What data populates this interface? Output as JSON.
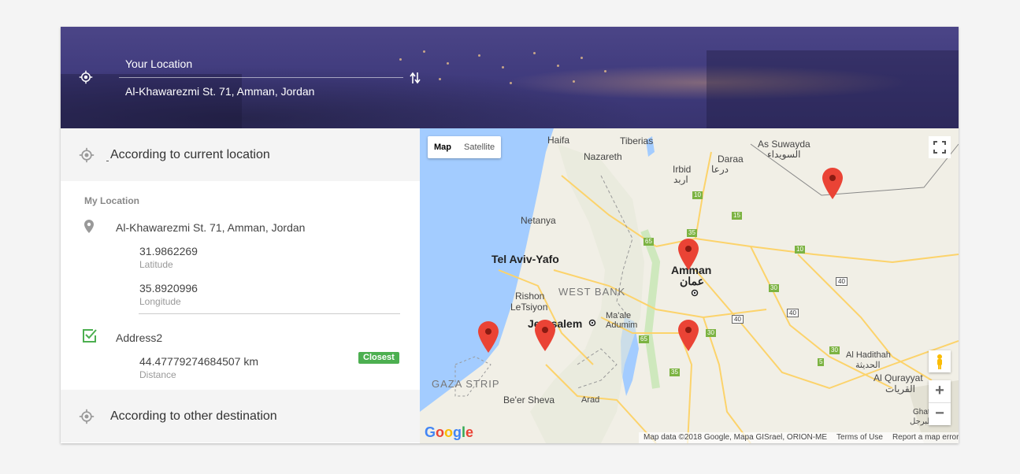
{
  "header": {
    "from_label": "Your Location",
    "to_label": "Al-Khawarezmi St. 71, Amman, Jordan",
    "icons": {
      "location": "crosshair-icon",
      "swap": "swap-vertical-icon"
    },
    "color": "#443f82"
  },
  "sections": {
    "current": {
      "label": "According to current location"
    },
    "other": {
      "label": "According to other destination"
    }
  },
  "details": {
    "heading": "My Location",
    "address": "Al-Khawarezmi St. 71, Amman, Jordan",
    "latitude": {
      "value": "31.9862269",
      "label": "Latitude"
    },
    "longitude": {
      "value": "35.8920996",
      "label": "Longitude"
    },
    "address2": {
      "name": "Address2",
      "distance": "44.47779274684507 km",
      "distance_label": "Distance",
      "badge": "Closest",
      "checked": true
    }
  },
  "map": {
    "type_buttons": {
      "map": "Map",
      "satellite": "Satellite"
    },
    "cities": {
      "haifa": "Haifa",
      "tiberias": "Tiberias",
      "nazareth": "Nazareth",
      "irbid": "Irbid",
      "irbid_ar": "اربد",
      "daraa": "Daraa",
      "daraa_ar": "درعا",
      "suwayda": "As Suwayda",
      "suwayda_ar": "السويداء",
      "netanya": "Netanya",
      "telaviv": "Tel Aviv-Yafo",
      "amman": "Amman",
      "amman_ar": "عمان",
      "rishon": "Rishon",
      "letsiyon": "LeTsiyon",
      "westbank": "WEST BANK",
      "jerusalem": "Jerusalem",
      "maale": "Ma'ale",
      "adumim": "Adumim",
      "gaza": "GAZA STRIP",
      "beersheva": "Be'er Sheva",
      "arad": "Arad",
      "hadithah": "Al Hadithah",
      "hadithah_ar": "الحديثة",
      "qurayyat": "Al Qurayyat",
      "qurayyat_ar": "القريات",
      "ghat": "Ghat",
      "ghat_ar": "طبرجل"
    },
    "shields": [
      "10",
      "15",
      "35",
      "65",
      "10",
      "40",
      "30",
      "40",
      "30",
      "40",
      "65",
      "30",
      "5",
      "35"
    ],
    "google_logo": "Google",
    "attribution": {
      "data": "Map data ©2018 Google, Mapa GISrael, ORION-ME",
      "terms": "Terms of Use",
      "report": "Report a map error"
    },
    "zoom": {
      "in": "+",
      "out": "−"
    },
    "colors": {
      "water": "#a3ccff",
      "land": "#f1efe6",
      "marker": "#ea4335",
      "road": "#fcd36b"
    }
  }
}
